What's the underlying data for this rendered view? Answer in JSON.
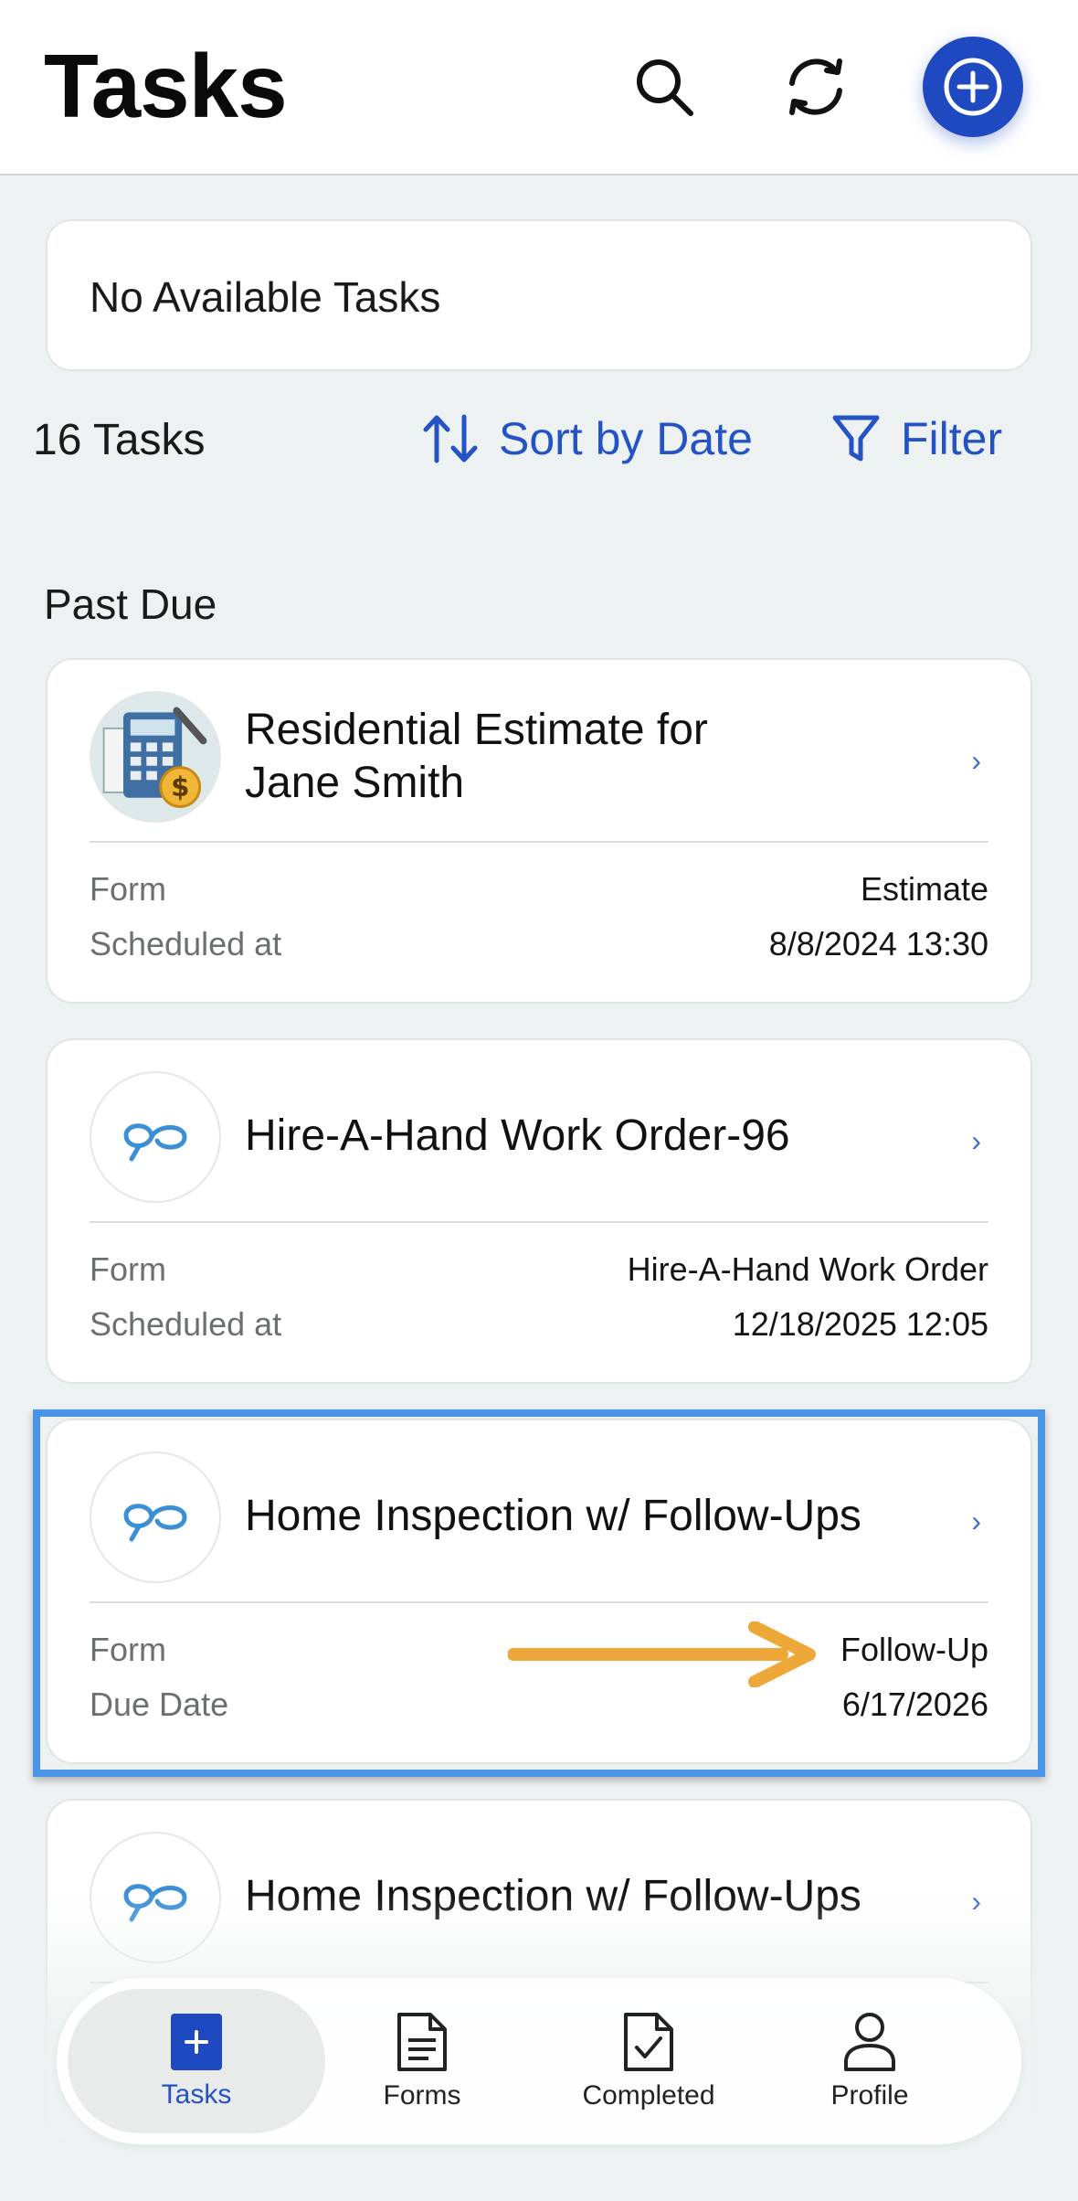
{
  "header": {
    "title": "Tasks"
  },
  "banner": {
    "text": "No Available Tasks"
  },
  "toolbar": {
    "count": "16 Tasks",
    "sort_label": "Sort by Date",
    "filter_label": "Filter"
  },
  "section": {
    "title": "Past Due"
  },
  "cards": [
    {
      "title_line1": "Residential Estimate for",
      "title_line2": "Jane Smith",
      "label1": "Form",
      "value1": "Estimate",
      "label2": "Scheduled at",
      "value2": "8/8/2024 13:30",
      "icon": "calculator-icon"
    },
    {
      "title": "Hire-A-Hand Work Order-96",
      "label1": "Form",
      "value1": "Hire-A-Hand Work Order",
      "label2": "Scheduled at",
      "value2": "12/18/2025 12:05",
      "icon": "form-logo-icon"
    },
    {
      "title": "Home Inspection w/ Follow-Ups",
      "label1": "Form",
      "value1": "Follow-Up",
      "label2": "Due Date",
      "value2": "6/17/2026",
      "icon": "form-logo-icon"
    },
    {
      "title": "Home Inspection w/ Follow-Ups",
      "icon": "form-logo-icon"
    }
  ],
  "chevron": "›",
  "tabs": [
    {
      "label": "Tasks",
      "icon": "tasks-icon",
      "active": true
    },
    {
      "label": "Forms",
      "icon": "document-icon"
    },
    {
      "label": "Completed",
      "icon": "completed-icon"
    },
    {
      "label": "Profile",
      "icon": "person-icon"
    }
  ],
  "colors": {
    "accent": "#2353c5",
    "highlight": "#4a94e8",
    "arrow": "#eea83a",
    "add_button": "#1f49c0"
  }
}
